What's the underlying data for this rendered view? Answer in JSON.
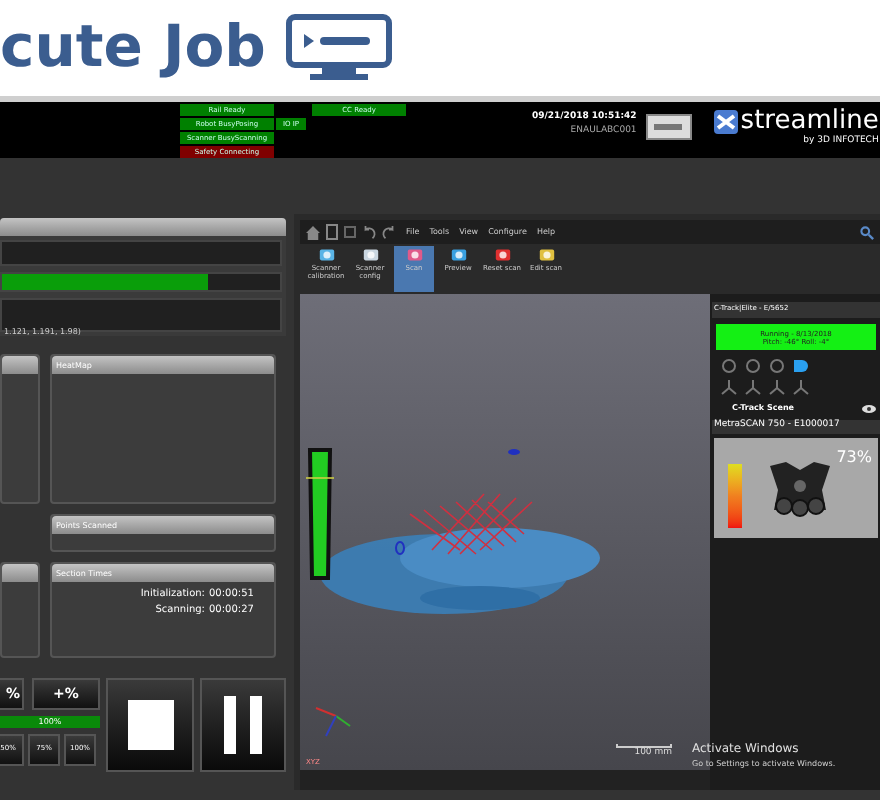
{
  "page_title": "cute Job",
  "status_columns": [
    {
      "items": [
        {
          "label": "Rail Ready",
          "color": "#008000"
        },
        {
          "label": "Robot BusyPosing",
          "color": "#008000"
        },
        {
          "label": "Scanner BusyScanning",
          "color": "#008000"
        },
        {
          "label": "Safety Connecting",
          "color": "#800000"
        }
      ]
    },
    {
      "items": [
        {
          "label": "IO IP",
          "color": "#008000"
        }
      ]
    },
    {
      "items": [
        {
          "label": "CC Ready",
          "color": "#008000"
        }
      ]
    }
  ],
  "datetime": "09/21/2018 10:51:42",
  "station": "ENAULABC001",
  "logo": {
    "name": "streamline",
    "tagline": "by 3D INFOTECH"
  },
  "job_panel": {
    "progress": {
      "level": 0.74
    },
    "coordinates": "1.121, 1.191, 1.98)"
  },
  "panels": [
    {
      "title": "HeatMap"
    },
    {
      "title": "Points Scanned"
    },
    {
      "title": "Section Times",
      "rows": [
        {
          "label": "Initialization:",
          "value": "00:00:51"
        },
        {
          "label": "Scanning:",
          "value": "00:00:27"
        }
      ]
    }
  ],
  "speed": {
    "decrease": "%",
    "increase": "+%",
    "level": 1,
    "reading": "100%",
    "presets": [
      "50%",
      "75%",
      "100%"
    ]
  },
  "app": {
    "menu": [
      "File",
      "Tools",
      "View",
      "Configure",
      "Help"
    ],
    "ribbon": [
      {
        "label": "Scanner calibration",
        "selected": false
      },
      {
        "label": "Scanner config",
        "selected": false
      },
      {
        "label": "Scan",
        "selected": true
      },
      {
        "label": "Preview",
        "selected": false
      },
      {
        "label": "Reset scan",
        "selected": false
      },
      {
        "label": "Edit scan",
        "selected": false
      }
    ]
  },
  "viewport": {
    "scale": "100 mm",
    "axis_label": "XYZ"
  },
  "tracker": {
    "title": "C-Track|Elite - E/5652",
    "status": [
      "Running - 8/13/2018",
      "Pitch: -46° Roll: -4°"
    ],
    "scene": "C-Track Scene"
  },
  "scanner": {
    "title": "MetraSCAN 750 - E1000017",
    "reading": "73%"
  },
  "os_notice": {
    "title": "Activate Windows",
    "text": "Go to Settings to activate Windows."
  }
}
